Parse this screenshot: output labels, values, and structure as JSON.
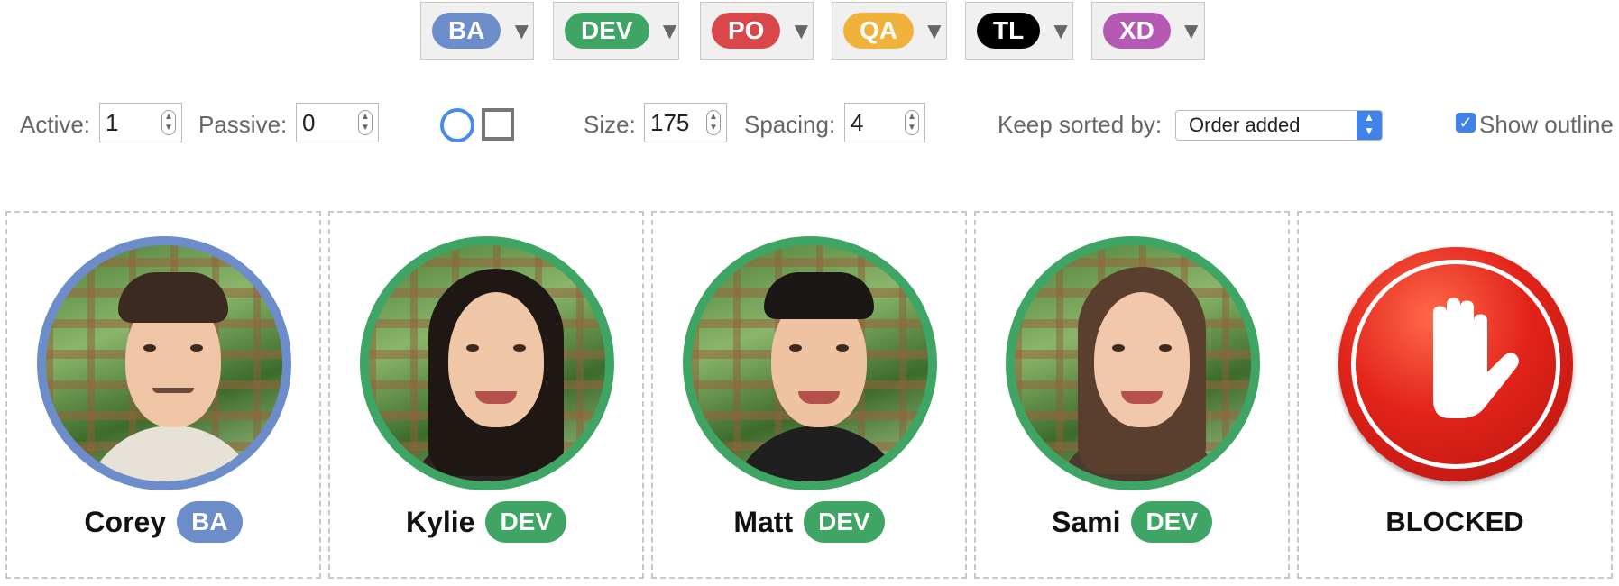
{
  "roles": [
    {
      "label": "BA",
      "color": "#6c8dc9"
    },
    {
      "label": "DEV",
      "color": "#3fa564"
    },
    {
      "label": "PO",
      "color": "#d9474a"
    },
    {
      "label": "QA",
      "color": "#f0b23a"
    },
    {
      "label": "TL",
      "color": "#000000"
    },
    {
      "label": "XD",
      "color": "#b45ab5"
    }
  ],
  "controls": {
    "active_label": "Active:",
    "active_value": "1",
    "passive_label": "Passive:",
    "passive_value": "0",
    "size_label": "Size:",
    "size_value": "175",
    "spacing_label": "Spacing:",
    "spacing_value": "4",
    "sort_label": "Keep sorted by:",
    "sort_value": "Order added",
    "show_outline_label": "Show outline",
    "show_outline_checked": true
  },
  "members": [
    {
      "name": "Corey",
      "role": "BA",
      "role_color": "#6c8dc9",
      "ring_color": "#6c8dc9"
    },
    {
      "name": "Kylie",
      "role": "DEV",
      "role_color": "#3fa564",
      "ring_color": "#3fa564"
    },
    {
      "name": "Matt",
      "role": "DEV",
      "role_color": "#3fa564",
      "ring_color": "#3fa564"
    },
    {
      "name": "Sami",
      "role": "DEV",
      "role_color": "#3fa564",
      "ring_color": "#3fa564"
    }
  ],
  "blocked": {
    "label": "BLOCKED",
    "icon": "stop-hand-icon"
  }
}
